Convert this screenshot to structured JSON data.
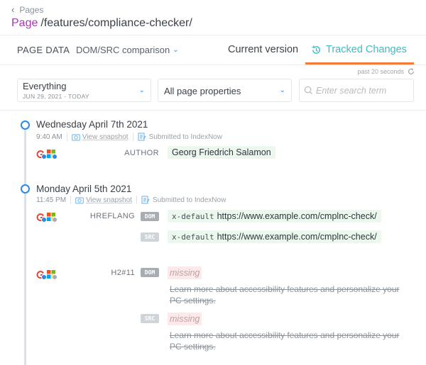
{
  "breadcrumb": {
    "back_label": "Pages"
  },
  "header": {
    "prefix": "Page",
    "path": "/features/compliance-checker/"
  },
  "toolbar": {
    "section_label": "PAGE DATA",
    "mode_label": "DOM/SRC comparison",
    "tabs": [
      {
        "label": "Current version",
        "active": false
      },
      {
        "label": "Tracked Changes",
        "active": true
      }
    ],
    "refresh_label": "past 20 seconds"
  },
  "filters": {
    "date_range": {
      "value": "Everything",
      "sub": "JUN 29, 2021 - TODAY"
    },
    "properties": {
      "value": "All page properties"
    },
    "search": {
      "placeholder": "Enter search term",
      "value": ""
    }
  },
  "colors": {
    "accent": "#3fbcc5",
    "tab_underline": "#f57b3d",
    "page_prefix": "#a63ab0",
    "timeline_dot": "#2a8ae6",
    "added_bg": "#ecf8ee",
    "missing_bg": "#fde9e9"
  },
  "timeline": [
    {
      "day": "Wednesday April 7th 2021",
      "time": "9:40 AM",
      "snapshot_label": "View snapshot",
      "indexnow_label": "Submitted to IndexNow",
      "changes": [
        {
          "engines": [
            {
              "name": "google",
              "status": "ok"
            },
            {
              "name": "bing",
              "status": "ok"
            }
          ],
          "property": "AUTHOR",
          "value": "Georg Friedrich Salamon"
        }
      ]
    },
    {
      "day": "Monday April 5th 2021",
      "time": "11:45 PM",
      "snapshot_label": "View snapshot",
      "indexnow_label": "Submitted to IndexNow",
      "changes": [
        {
          "engines": [
            {
              "name": "google",
              "status": "ok"
            },
            {
              "name": "bing",
              "status": "pending"
            }
          ],
          "property": "HREFLANG",
          "dom": {
            "tag": "DOM",
            "code": "x-default",
            "value": "https://www.example.com/cmplnc-check/"
          },
          "src": {
            "tag": "SRC",
            "code": "x-default",
            "value": "https://www.example.com/cmplnc-check/"
          }
        },
        {
          "engines": [
            {
              "name": "google",
              "status": "ok"
            },
            {
              "name": "bing",
              "status": "pending"
            }
          ],
          "property": "H2#11",
          "dom": {
            "tag": "DOM",
            "value": "missing",
            "removed": "Learn more about accessibility features and personalize your PC settings."
          },
          "src": {
            "tag": "SRC",
            "value": "missing",
            "removed": "Learn more about accessibility features and personalize your PC settings."
          }
        }
      ]
    }
  ]
}
